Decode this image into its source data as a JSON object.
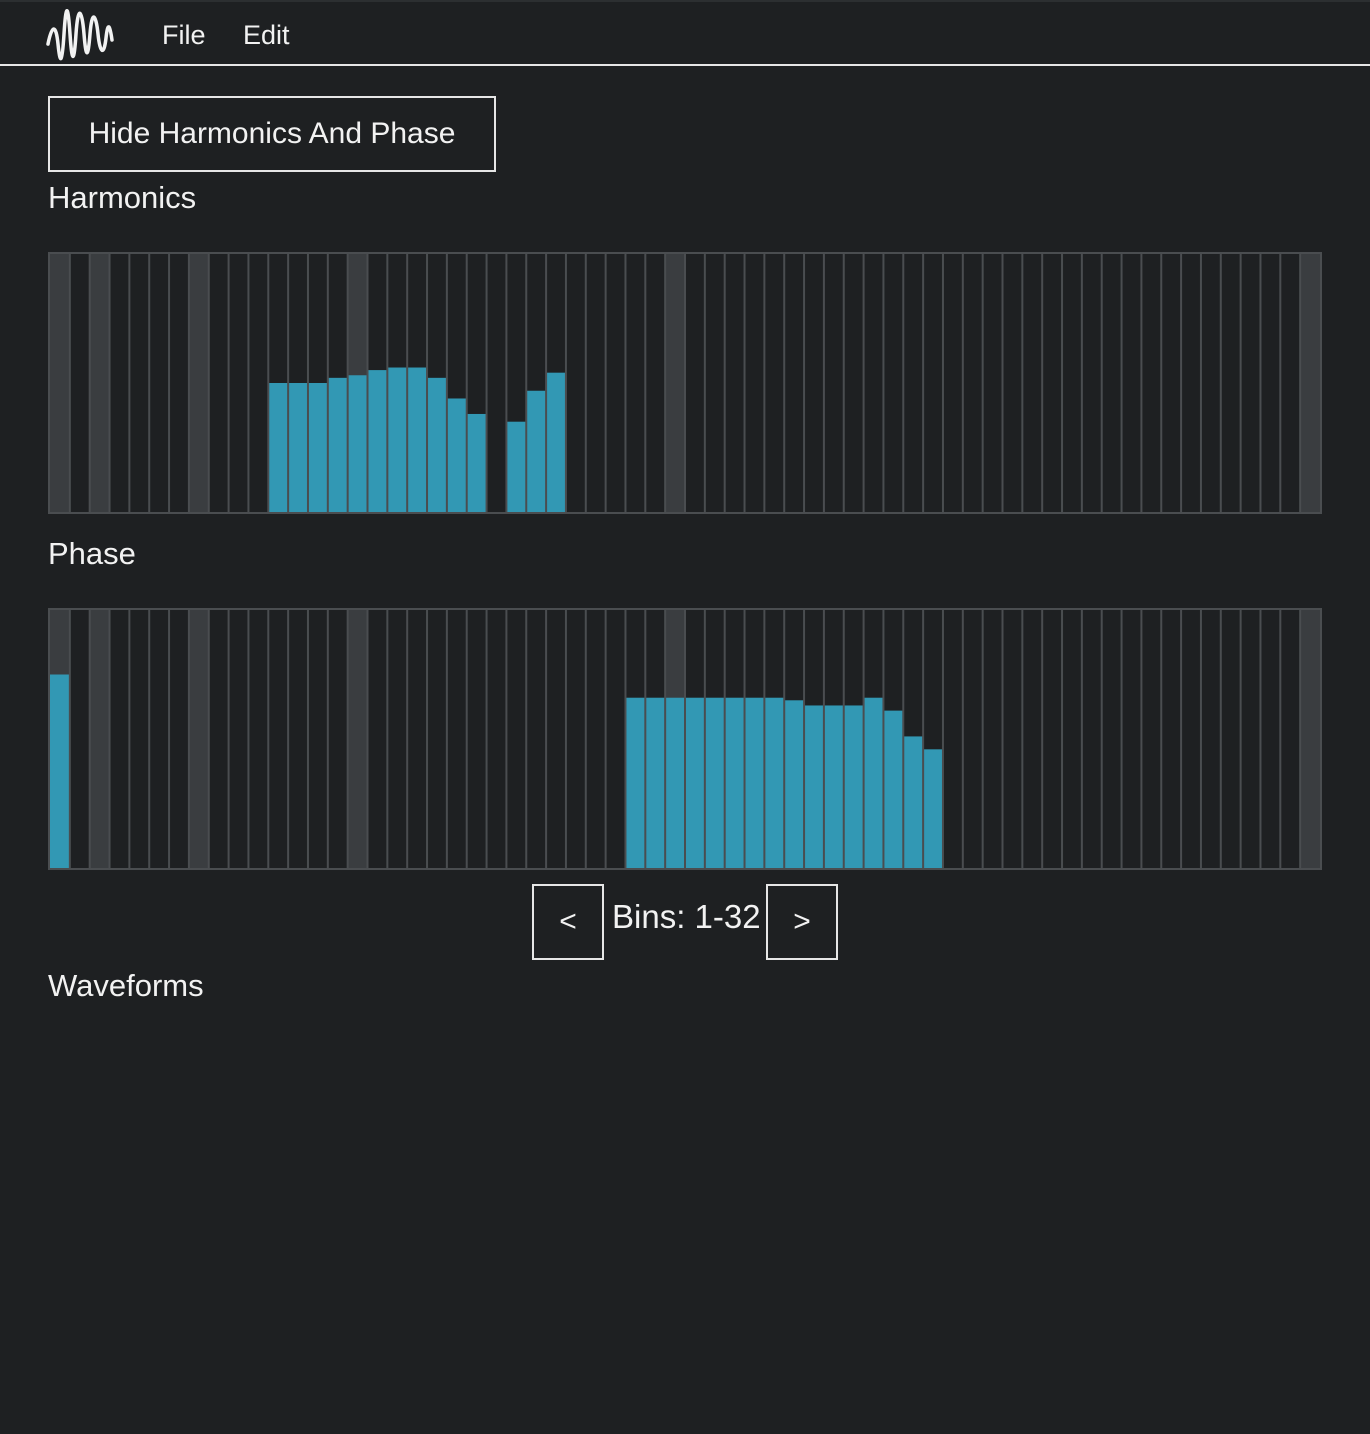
{
  "menu": {
    "logo_icon": "waveform-logo-icon",
    "items": [
      {
        "label": "File"
      },
      {
        "label": "Edit"
      }
    ]
  },
  "toggle_button": {
    "label": "Hide Harmonics And Phase"
  },
  "harmonics": {
    "label": "Harmonics",
    "bin_count": 64,
    "highlighted_bins": [
      1,
      3,
      8,
      16,
      32,
      64
    ],
    "values": [
      0,
      0,
      0,
      0,
      0,
      0,
      0,
      0,
      0,
      0,
      0,
      0.5,
      0.5,
      0.5,
      0.52,
      0.53,
      0.55,
      0.56,
      0.56,
      0.52,
      0.44,
      0.38,
      0,
      0.35,
      0.47,
      0.54,
      0,
      0,
      0,
      0,
      0,
      0,
      0,
      0,
      0,
      0,
      0,
      0,
      0,
      0,
      0,
      0,
      0,
      0,
      0,
      0,
      0,
      0,
      0,
      0,
      0,
      0,
      0,
      0,
      0,
      0,
      0,
      0,
      0,
      0,
      0,
      0,
      0,
      0
    ]
  },
  "phase": {
    "label": "Phase",
    "bin_count": 64,
    "highlighted_bins": [
      1,
      3,
      8,
      16,
      32,
      64
    ],
    "values": [
      0.75,
      0,
      0,
      0,
      0,
      0,
      0,
      0,
      0,
      0,
      0,
      0,
      0,
      0,
      0,
      0,
      0,
      0,
      0,
      0,
      0,
      0,
      0,
      0,
      0,
      0,
      0,
      0,
      0,
      0.66,
      0.66,
      0.66,
      0.66,
      0.66,
      0.66,
      0.66,
      0.66,
      0.65,
      0.63,
      0.63,
      0.63,
      0.66,
      0.61,
      0.51,
      0.46,
      0,
      0,
      0,
      0,
      0,
      0,
      0,
      0,
      0,
      0,
      0,
      0,
      0,
      0,
      0,
      0,
      0,
      0,
      0
    ]
  },
  "pager": {
    "prev_label": "<",
    "next_label": ">",
    "bins_text": "Bins: 1-32"
  },
  "waveforms": {
    "label": "Waveforms"
  },
  "colors": {
    "background": "#1e2022",
    "bar_fill": "#3298b4",
    "highlight_bin": "#3a3d40",
    "divider": "#4a4d50"
  }
}
